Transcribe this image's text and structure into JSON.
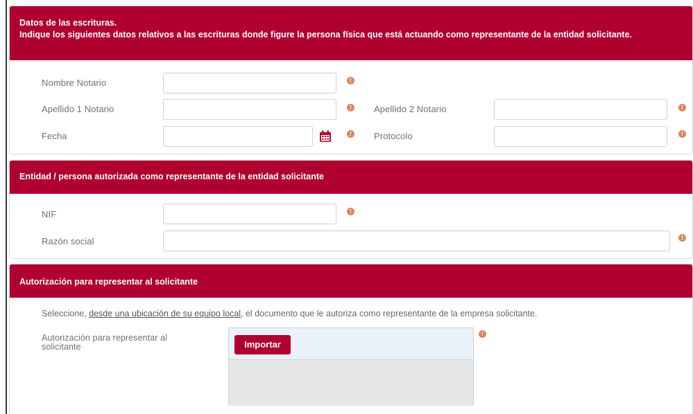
{
  "section1": {
    "header_line1": "Datos de las escrituras.",
    "header_line2": "Indique los siguientes datos relativos a las escrituras donde figure la persona física que está actuando como representante de la entidad solicitante.",
    "nombre_notario_label": "Nombre Notario",
    "apellido1_label": "Apellido 1 Notario",
    "apellido2_label": "Apellido 2 Notario",
    "fecha_label": "Fecha",
    "protocolo_label": "Protocolo",
    "nombre_notario_value": "",
    "apellido1_value": "",
    "apellido2_value": "",
    "fecha_value": "",
    "protocolo_value": ""
  },
  "section2": {
    "header": "Entidad / persona autorizada como representante de la entidad solicitante",
    "nif_label": "NIF",
    "razon_social_label": "Razón social",
    "nif_value": "",
    "razon_social_value": ""
  },
  "section3": {
    "header": "Autorización para representar al solicitante",
    "help_prefix": "Seleccione, ",
    "help_link": "desde una ubicación de su equipo local",
    "help_suffix": ", el documento que le autoriza como representante de la empresa solicitante.",
    "upload_label": "Autorización para representar al solicitante",
    "import_button": "Importar"
  },
  "icons": {
    "warning": "exclamation-circle",
    "calendar": "calendar"
  },
  "colors": {
    "header_bg": "#b0002f",
    "warning": "#d98762"
  }
}
